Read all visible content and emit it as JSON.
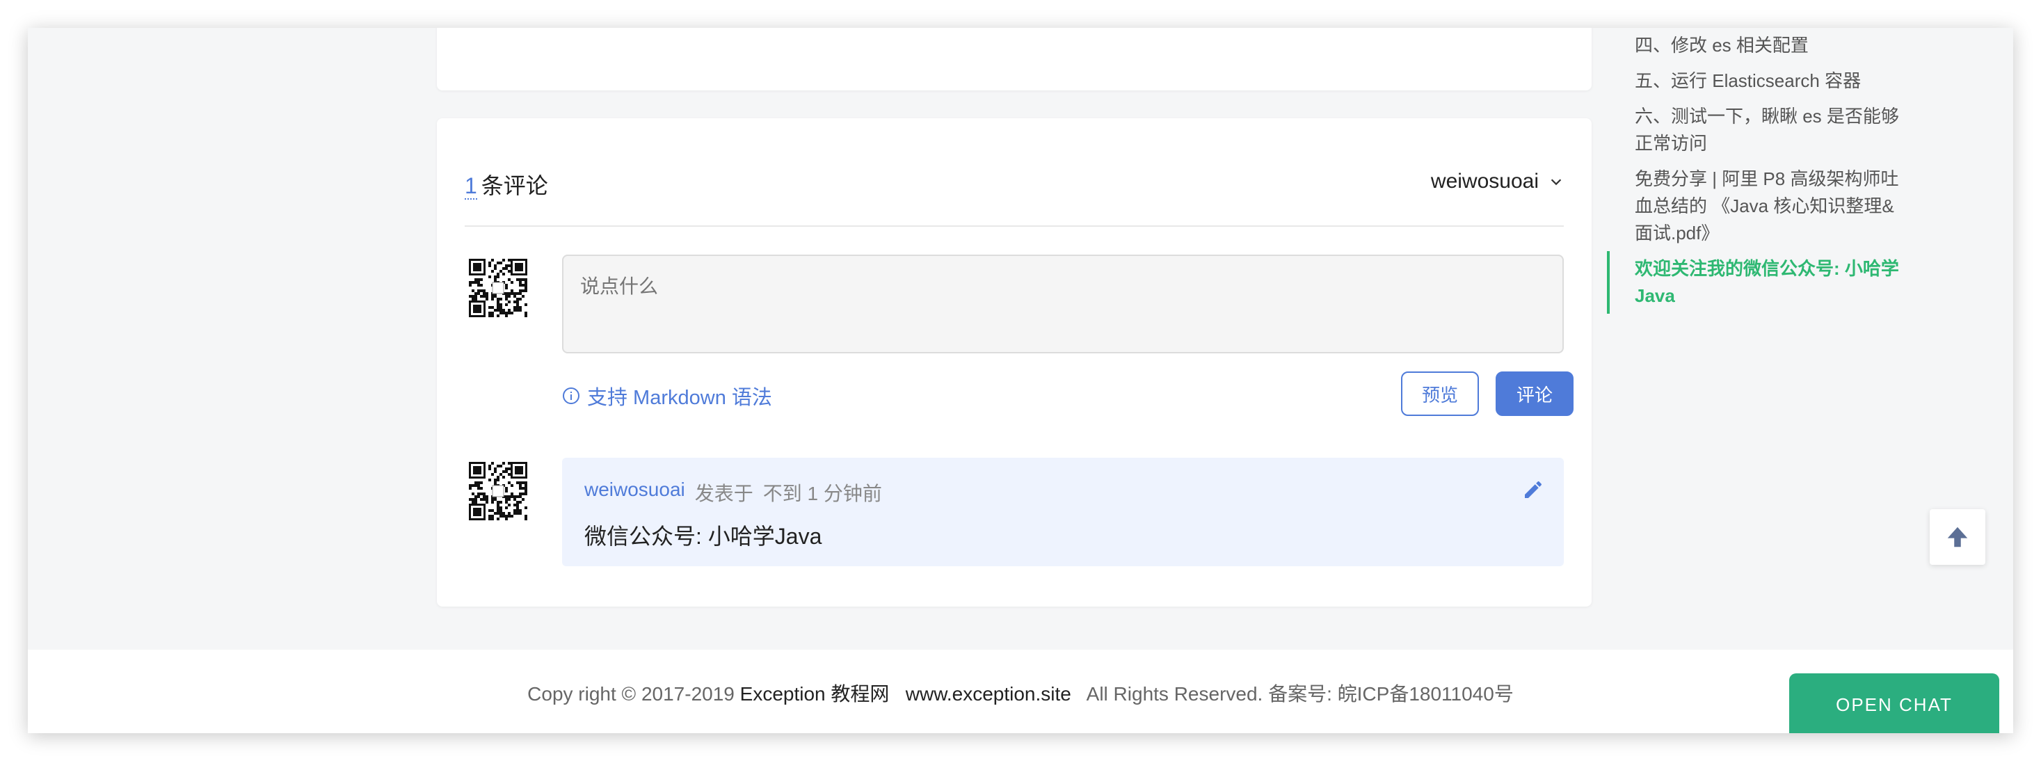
{
  "comments": {
    "count": "1",
    "count_label": "条评论",
    "current_user": "weiwosuoai",
    "input_placeholder": "说点什么",
    "markdown_hint": "支持 Markdown 语法",
    "preview_label": "预览",
    "submit_label": "评论",
    "items": [
      {
        "author": "weiwosuoai",
        "posted_label": "发表于",
        "time": "不到 1 分钟前",
        "body": "微信公众号: 小哈学Java"
      }
    ]
  },
  "toc": {
    "items": [
      {
        "label": "四、修改 es 相关配置",
        "active": false
      },
      {
        "label": "五、运行 Elasticsearch 容器",
        "active": false
      },
      {
        "label": "六、测试一下，瞅瞅 es 是否能够正常访问",
        "active": false
      },
      {
        "label": "免费分享 | 阿里 P8 高级架构师吐血总结的 《Java 核心知识整理&面试.pdf》",
        "active": false
      },
      {
        "label": "欢迎关注我的微信公众号: 小哈学Java",
        "active": true
      }
    ]
  },
  "footer": {
    "copyright": "Copy right © 2017-2019",
    "site_name": "Exception 教程网",
    "site_url": "www.exception.site",
    "rights": "All Rights Reserved. 备案号: 皖ICP备18011040号"
  },
  "chat": {
    "label": "OPEN CHAT"
  },
  "icons": {
    "chevron": "chevron-down-icon",
    "info": "info-icon",
    "edit": "pencil-icon",
    "back_to_top": "arrow-up-icon",
    "avatar": "qr-code-avatar"
  },
  "colors": {
    "accent": "#4f7bd9",
    "toc_active": "#2eb872",
    "chat_button": "#2bae7f",
    "comment_bg": "#eef3fe"
  }
}
